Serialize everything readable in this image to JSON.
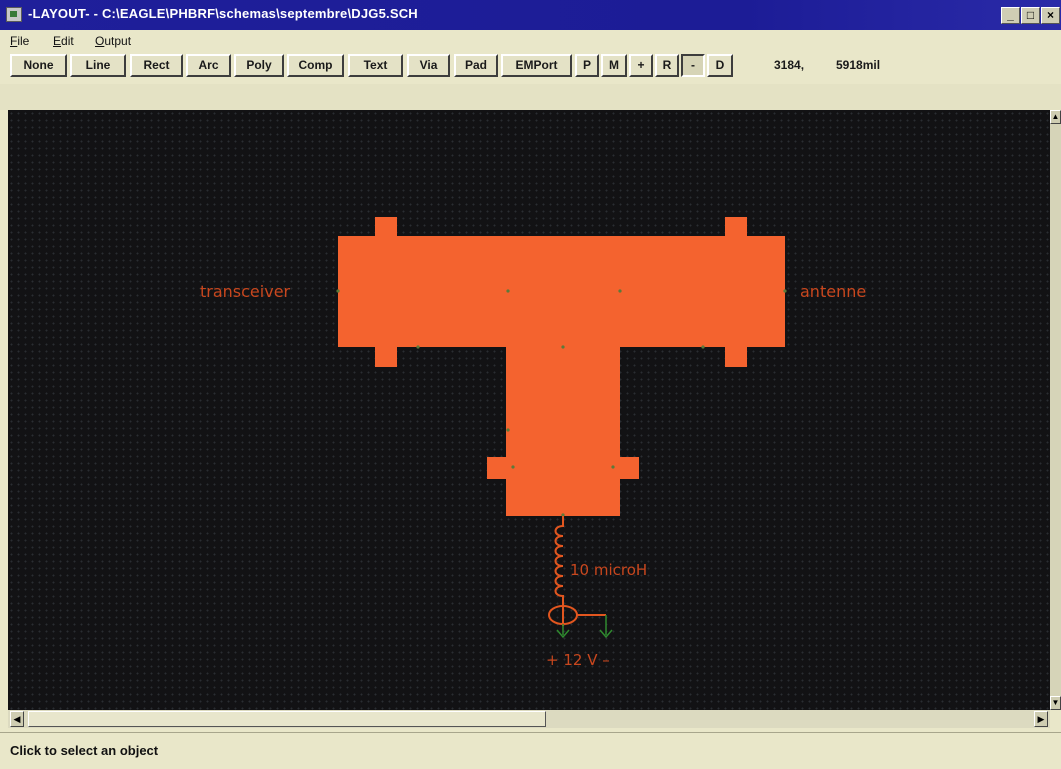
{
  "window": {
    "title": "-LAYOUT- - C:\\EAGLE\\PHBRF\\schemas\\septembre\\DJG5.SCH",
    "controls": {
      "minimize": "_",
      "maximize": "□",
      "close": "×"
    }
  },
  "menu": {
    "file": {
      "first": "F",
      "rest": "ile"
    },
    "edit": {
      "first": "E",
      "rest": "dit"
    },
    "output": {
      "first": "O",
      "rest": "utput"
    }
  },
  "toolbar": {
    "buttons": [
      "None",
      "Line",
      "Rect",
      "Arc",
      "Poly",
      "Comp",
      "Text",
      "Via",
      "Pad",
      "EMPort",
      "P",
      "M",
      "+",
      "R",
      "-",
      "D"
    ],
    "active": "-",
    "coord_x": "3184,",
    "coord_y": "5918mil"
  },
  "layout": {
    "label_left": "transceiver",
    "label_right": "antenne",
    "inductor_label": "10 microH",
    "supply_label": "+ 12 V –",
    "colors": {
      "background": "#121214",
      "copper": "#f4632f",
      "label": "#c8471e",
      "node": "#5a7a3a",
      "ground": "#2f8a2f"
    }
  },
  "scrollbars": {
    "left_arrow": "◀",
    "right_arrow": "▶",
    "up_arrow": "▲",
    "down_arrow": "▼"
  },
  "status": {
    "text": "Click to select an object"
  }
}
